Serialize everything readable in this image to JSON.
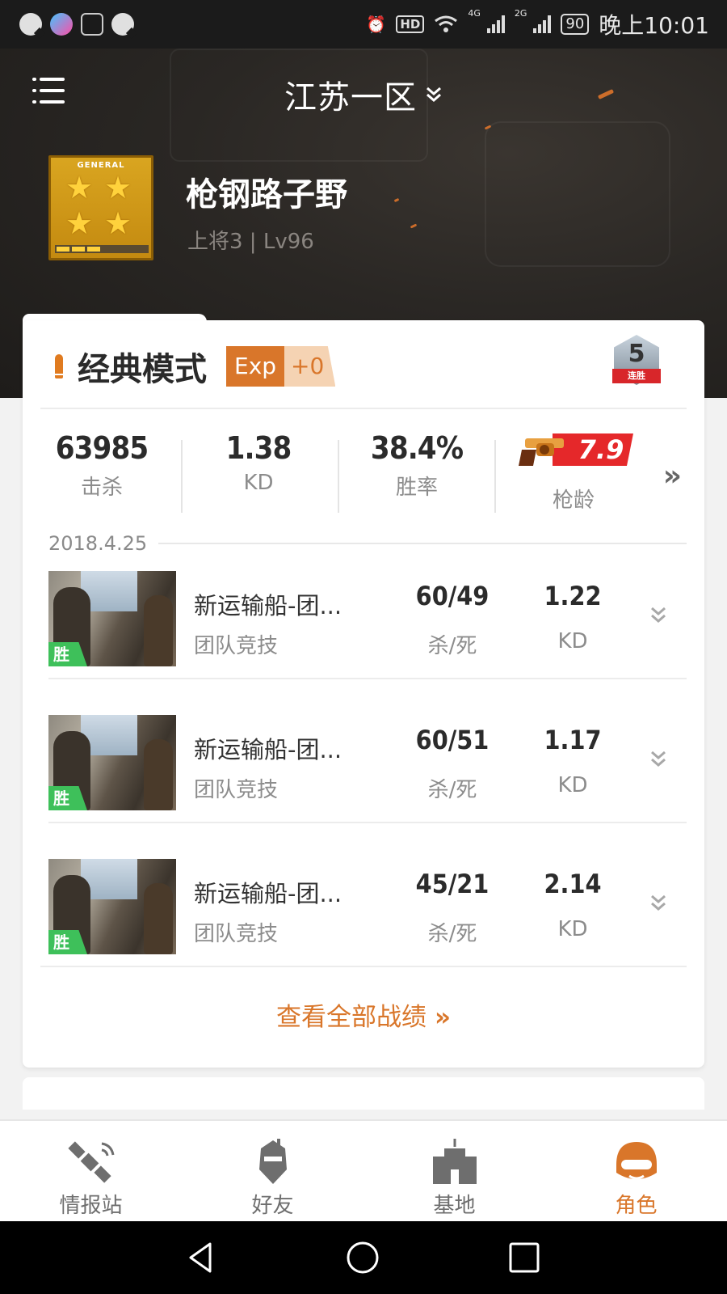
{
  "status_bar": {
    "network_1": "4G",
    "network_2": "2G",
    "battery": "90",
    "time": "晚上10:01"
  },
  "header": {
    "server": "江苏一区",
    "rank_badge_text": "GENERAL",
    "player_name": "枪钢路子野",
    "player_level": "上将3 | Lv96"
  },
  "mode_card": {
    "title": "经典模式",
    "exp_label": "Exp",
    "exp_value": "+0",
    "streak_number": "5",
    "streak_label": "连胜",
    "stats": [
      {
        "value": "63985",
        "label": "击杀"
      },
      {
        "value": "1.38",
        "label": "KD"
      },
      {
        "value": "38.4%",
        "label": "胜率"
      }
    ],
    "gun_age": {
      "value": "7.9",
      "label": "枪龄"
    },
    "date": "2018.4.25",
    "matches": [
      {
        "result": "胜",
        "map": "新运输船-团...",
        "mode": "团队竞技",
        "kills_deaths": "60/49",
        "kd_label": "杀/死",
        "kd": "1.22",
        "kd_caption": "KD"
      },
      {
        "result": "胜",
        "map": "新运输船-团...",
        "mode": "团队竞技",
        "kills_deaths": "60/51",
        "kd_label": "杀/死",
        "kd": "1.17",
        "kd_caption": "KD"
      },
      {
        "result": "胜",
        "map": "新运输船-团...",
        "mode": "团队竞技",
        "kills_deaths": "45/21",
        "kd_label": "杀/死",
        "kd": "2.14",
        "kd_caption": "KD"
      }
    ],
    "view_all": "查看全部战绩"
  },
  "bottom_nav": {
    "items": [
      {
        "label": "情报站",
        "icon": "satellite-icon"
      },
      {
        "label": "好友",
        "icon": "soldier-icon"
      },
      {
        "label": "基地",
        "icon": "castle-icon"
      },
      {
        "label": "角色",
        "icon": "helmet-icon"
      }
    ],
    "active_index": 3
  },
  "colors": {
    "accent": "#d9762a",
    "win": "#3ec05a",
    "header_bg": "#26231f"
  }
}
